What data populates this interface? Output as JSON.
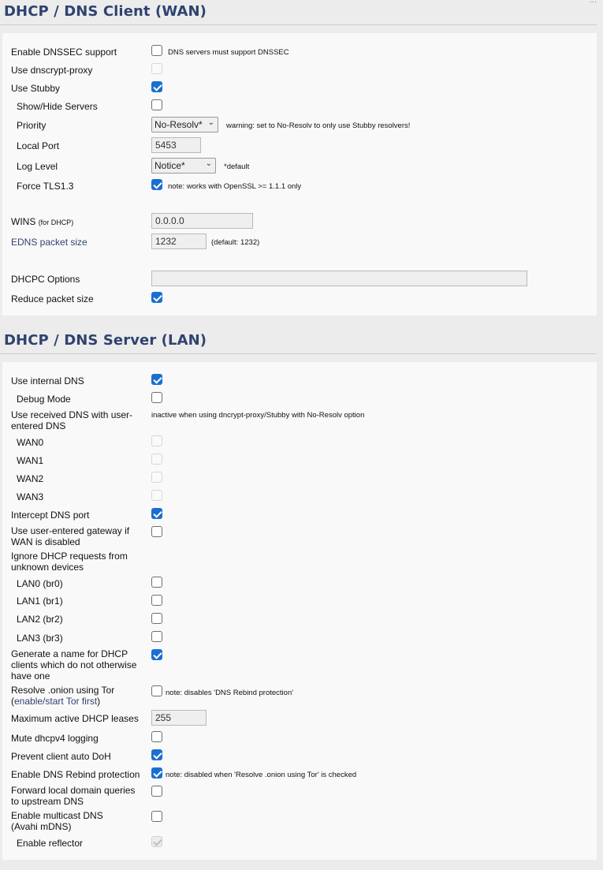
{
  "top_cut_text": "...",
  "wan": {
    "title": "DHCP / DNS Client (WAN)",
    "dnssec": {
      "label": "Enable DNSSEC support",
      "note": "DNS servers must support DNSSEC"
    },
    "dnscrypt": {
      "label": "Use dnscrypt-proxy"
    },
    "stubby": {
      "label": "Use Stubby"
    },
    "showhide": {
      "label": "Show/Hide Servers"
    },
    "priority": {
      "label": "Priority",
      "value": "No-Resolv*",
      "note": "warning: set to No-Resolv to only use Stubby resolvers!"
    },
    "local_port": {
      "label": "Local Port",
      "value": "5453"
    },
    "log_level": {
      "label": "Log Level",
      "value": "Notice*",
      "note": "*default"
    },
    "force_tls": {
      "label": "Force TLS1.3",
      "note": "note: works with OpenSSL >= 1.1.1 only"
    },
    "wins": {
      "label": "WINS",
      "label_small": "(for DHCP)",
      "value": "0.0.0.0"
    },
    "edns": {
      "label": "EDNS packet size",
      "value": "1232",
      "note": "(default: 1232)"
    },
    "dhcpc_options": {
      "label": "DHCPC Options",
      "value": ""
    },
    "reduce_packet": {
      "label": "Reduce packet size"
    }
  },
  "lan": {
    "title": "DHCP / DNS Server (LAN)",
    "internal_dns": {
      "label": "Use internal DNS"
    },
    "debug_mode": {
      "label": "Debug Mode"
    },
    "received_dns": {
      "label_line1": "Use received DNS with user-",
      "label_line2": "entered DNS",
      "note": "inactive when using dncrypt-proxy/Stubby with No-Resolv option"
    },
    "wan0": {
      "label": "WAN0"
    },
    "wan1": {
      "label": "WAN1"
    },
    "wan2": {
      "label": "WAN2"
    },
    "wan3": {
      "label": "WAN3"
    },
    "intercept": {
      "label": "Intercept DNS port"
    },
    "gateway": {
      "label_line1": "Use user-entered gateway if",
      "label_line2": "WAN is disabled"
    },
    "ignore_dhcp": {
      "label_line1": "Ignore DHCP requests from",
      "label_line2": "unknown devices"
    },
    "lan0": {
      "label": "LAN0 (br0)"
    },
    "lan1": {
      "label": "LAN1 (br1)"
    },
    "lan2": {
      "label": "LAN2 (br2)"
    },
    "lan3": {
      "label": "LAN3 (br3)"
    },
    "generate_name": {
      "label_line1": "Generate a name for DHCP",
      "label_line2": "clients which do not otherwise",
      "label_line3": "have one"
    },
    "onion": {
      "label_line1": "Resolve .onion using Tor",
      "link": "enable/start Tor first",
      "note": "note: disables 'DNS Rebind protection'"
    },
    "max_leases": {
      "label": "Maximum active DHCP leases",
      "value": "255"
    },
    "mute_dhcpv4": {
      "label": "Mute dhcpv4 logging"
    },
    "prevent_doh": {
      "label": "Prevent client auto DoH"
    },
    "rebind": {
      "label": "Enable DNS Rebind protection",
      "note": "note: disabled when 'Resolve .onion using Tor' is checked"
    },
    "forward_local": {
      "label_line1": "Forward local domain queries",
      "label_line2": "to upstream DNS"
    },
    "multicast": {
      "label_line1": "Enable multicast DNS",
      "label_line2": "(Avahi mDNS)"
    },
    "reflector": {
      "label": "Enable reflector"
    }
  }
}
